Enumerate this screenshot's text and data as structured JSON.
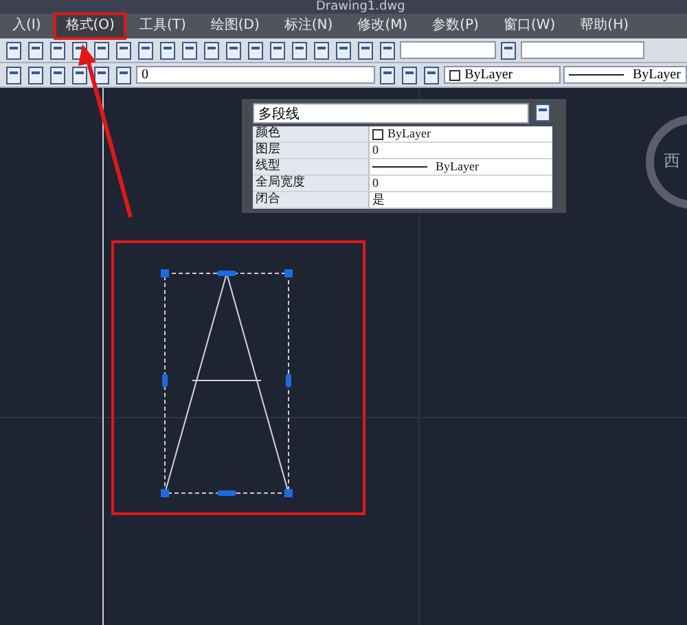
{
  "title_bar": {
    "title": "Drawing1.dwg"
  },
  "menu": [
    {
      "label": "入(I)",
      "highlighted": false
    },
    {
      "label": "格式(O)",
      "highlighted": true
    },
    {
      "label": "工具(T)",
      "highlighted": false
    },
    {
      "label": "绘图(D)",
      "highlighted": false
    },
    {
      "label": "标注(N)",
      "highlighted": false
    },
    {
      "label": "修改(M)",
      "highlighted": false
    },
    {
      "label": "参数(P)",
      "highlighted": false
    },
    {
      "label": "窗口(W)",
      "highlighted": false
    },
    {
      "label": "帮助(H)",
      "highlighted": false
    }
  ],
  "layer_bar": {
    "layer": "0",
    "color_setting": "ByLayer",
    "linetype": "ByLayer"
  },
  "properties": {
    "object_type": "多段线",
    "rows": [
      {
        "label": "颜色",
        "value": "ByLayer",
        "kind": "color"
      },
      {
        "label": "图层",
        "value": "0",
        "kind": "text"
      },
      {
        "label": "线型",
        "value": "ByLayer",
        "kind": "linetype"
      },
      {
        "label": "全局宽度",
        "value": "0",
        "kind": "text"
      },
      {
        "label": "闭合",
        "value": "是",
        "kind": "text"
      }
    ]
  },
  "viewcube": {
    "label": "西"
  }
}
